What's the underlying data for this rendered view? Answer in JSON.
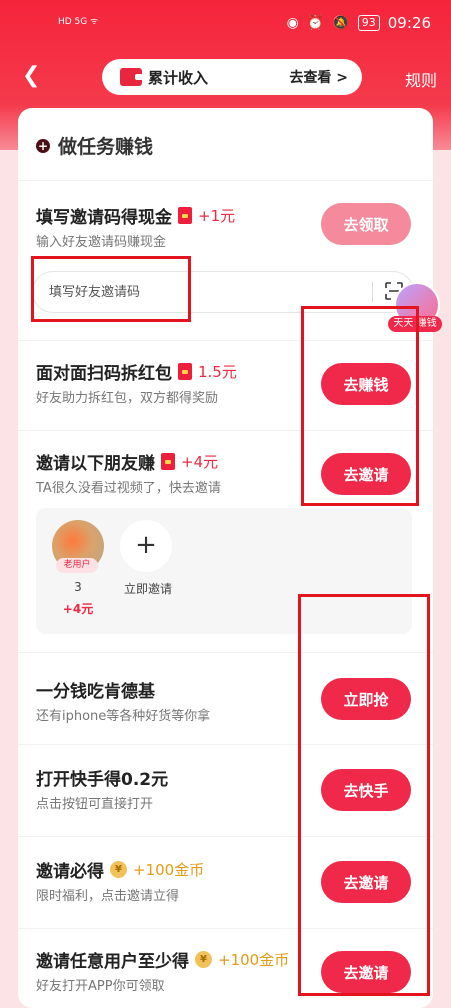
{
  "status_bar": {
    "left_icons": "HD 5G ᯤ",
    "battery": "93",
    "time": "09:26"
  },
  "nav": {
    "income_label": "累计收入",
    "income_link": "去查看 >",
    "rules": "规则"
  },
  "section": {
    "title": "做任务赚钱"
  },
  "tasks": [
    {
      "title": "填写邀请码得现金",
      "reward": "+1元",
      "subtitle": "输入好友邀请码赚现金",
      "button": "去领取"
    },
    {
      "title": "面对面扫码拆红包",
      "reward": "1.5元",
      "subtitle": "好友助力拆红包，双方都得奖励",
      "button": "去赚钱"
    },
    {
      "title": "邀请以下朋友赚",
      "reward": "+4元",
      "subtitle": "TA很久没看过视频了，快去邀请",
      "button": "去邀请"
    },
    {
      "title": "一分钱吃肯德基",
      "subtitle": "还有iphone等各种好货等你拿",
      "button": "立即抢"
    },
    {
      "title": "打开快手得0.2元",
      "subtitle": "点击按钮可直接打开",
      "button": "去快手"
    },
    {
      "title": "邀请必得",
      "reward": "+100金币",
      "subtitle": "限时福利，点击邀请立得",
      "button": "去邀请"
    },
    {
      "title": "邀请任意用户至少得",
      "reward": "+100金币",
      "subtitle": "好友打开APP你可领取",
      "button": "去邀请"
    }
  ],
  "invite_input": {
    "placeholder": "填写好友邀请码"
  },
  "float_badge": {
    "label": "天天 赚钱"
  },
  "friends": {
    "tag": "老用户",
    "count": "3",
    "reward": "+4元",
    "add_label": "立即邀请"
  },
  "colors": {
    "accent": "#f0294a",
    "gold": "#e39a17",
    "header": "#f5243b"
  }
}
